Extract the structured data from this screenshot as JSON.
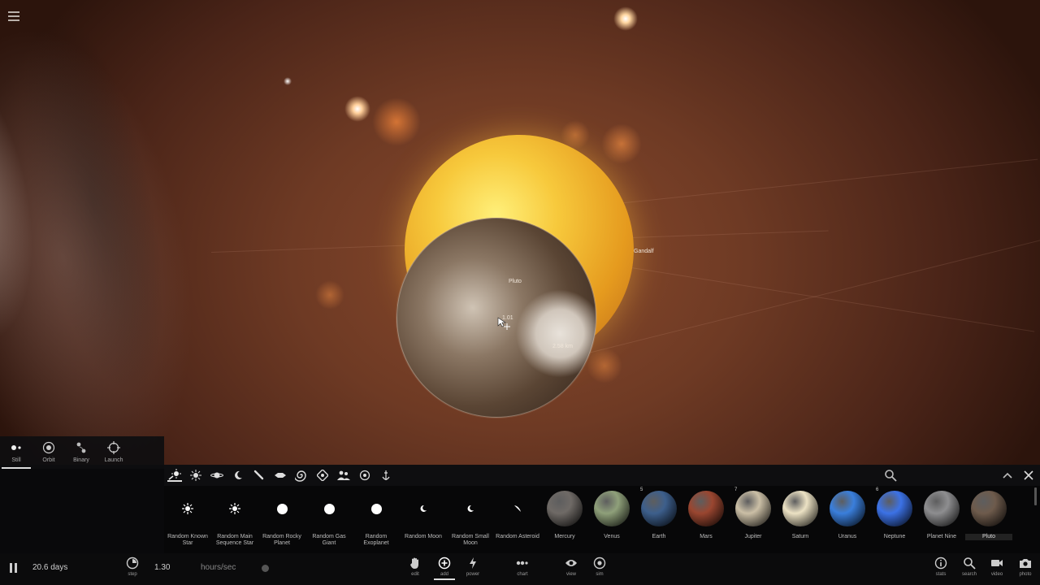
{
  "scene": {
    "labels": {
      "star": "Gandalf",
      "moon": "Pluto",
      "cursor_readout": "1.01",
      "distance": "2.58 km"
    }
  },
  "mode_tabs": [
    {
      "label": "Still",
      "icon": "still-icon",
      "active": true
    },
    {
      "label": "Orbit",
      "icon": "orbit-icon",
      "active": false
    },
    {
      "label": "Binary",
      "icon": "binary-icon",
      "active": false
    },
    {
      "label": "Launch",
      "icon": "launch-icon",
      "active": false
    }
  ],
  "categories": [
    "stars-category-icon",
    "sun-category-icon",
    "planet-category-icon",
    "moon-category-icon",
    "comet-category-icon",
    "spaceship-category-icon",
    "galaxy-category-icon",
    "ring-category-icon",
    "people-category-icon",
    "sandbox-category-icon",
    "anchor-category-icon"
  ],
  "items": [
    {
      "label": "Random Known Star",
      "kind": "star"
    },
    {
      "label": "Random Main Sequence Star",
      "kind": "star"
    },
    {
      "label": "Random Rocky Planet",
      "kind": "dot"
    },
    {
      "label": "Random Gas Giant",
      "kind": "dot"
    },
    {
      "label": "Random Exoplanet",
      "kind": "dot"
    },
    {
      "label": "Random Moon",
      "kind": "crescent"
    },
    {
      "label": "Random Small Moon",
      "kind": "crescent"
    },
    {
      "label": "Random Asteroid",
      "kind": "asteroid"
    },
    {
      "label": "Mercury",
      "kind": "planet",
      "color": "#6f6a66",
      "badge": ""
    },
    {
      "label": "Venus",
      "kind": "planet",
      "color": "#8fa07a",
      "badge": ""
    },
    {
      "label": "Earth",
      "kind": "planet",
      "color": "#3d5f8c",
      "badge": "5"
    },
    {
      "label": "Mars",
      "kind": "planet",
      "color": "#9a4630",
      "badge": ""
    },
    {
      "label": "Jupiter",
      "kind": "planet",
      "color": "#cbbfa6",
      "badge": "7"
    },
    {
      "label": "Saturn",
      "kind": "planet",
      "color": "#ece2c4",
      "badge": ""
    },
    {
      "label": "Uranus",
      "kind": "planet",
      "color": "#3a7fdc",
      "badge": ""
    },
    {
      "label": "Neptune",
      "kind": "planet",
      "color": "#3c72e6",
      "badge": "6"
    },
    {
      "label": "Planet Nine",
      "kind": "planet",
      "color": "#8e8e90",
      "badge": ""
    },
    {
      "label": "Pluto",
      "kind": "planet",
      "color": "#6e5b4c",
      "badge": "",
      "selected": true
    }
  ],
  "toolbar": {
    "time": "20.6 days",
    "step_label": "step",
    "rate_value": "1.30",
    "rate_unit": "hours/sec",
    "tools": [
      {
        "label": "edit",
        "icon": "hand-icon"
      },
      {
        "label": "add",
        "icon": "add-icon",
        "active": true
      },
      {
        "label": "power",
        "icon": "power-icon"
      },
      {
        "label": "chart",
        "icon": "chart-icon"
      },
      {
        "label": "view",
        "icon": "eye-icon"
      },
      {
        "label": "sim",
        "icon": "sim-icon"
      }
    ],
    "right_tools": [
      {
        "label": "stats",
        "icon": "info-icon"
      },
      {
        "label": "search",
        "icon": "search-icon"
      },
      {
        "label": "video",
        "icon": "video-icon"
      },
      {
        "label": "photo",
        "icon": "camera-icon"
      }
    ]
  }
}
